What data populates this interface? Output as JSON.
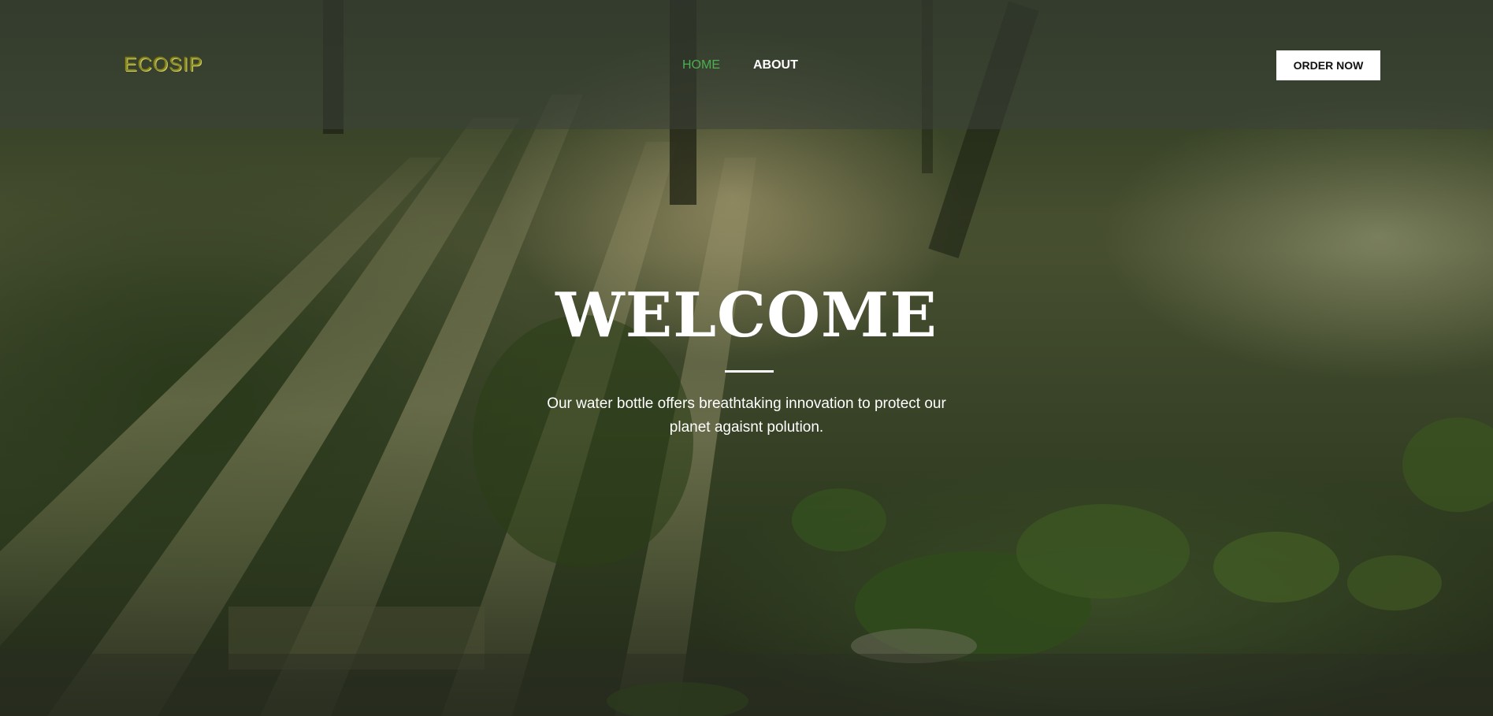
{
  "header": {
    "logo": "ECOSIP",
    "nav": [
      {
        "label": "HOME",
        "active": true
      },
      {
        "label": "ABOUT",
        "active": false
      }
    ],
    "order_button": "ORDER NOW"
  },
  "hero": {
    "title": "WELCOME",
    "subtitle_line1": "Our water bottle offers breathtaking innovation to protect our",
    "subtitle_line2": "planet agaisnt polution.",
    "background": "forest-sunbeams-image"
  },
  "colors": {
    "nav_active": "#4caf50",
    "logo": "#8a8a2a",
    "button_bg": "#ffffff"
  }
}
